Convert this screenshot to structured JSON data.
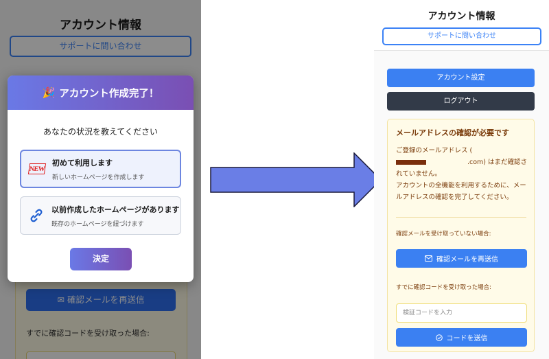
{
  "left": {
    "background": {
      "title": "アカウント情報",
      "support_button": "サポートに問い合わせ",
      "resend_button": "確認メールを再送信",
      "code_label": "すでに確認コードを受け取った場合:"
    },
    "modal": {
      "title": "アカウント作成完了！",
      "question": "あなたの状況を教えてください",
      "options": [
        {
          "title": "初めて利用します",
          "desc": "新しいホームページを作成します",
          "icon": "new-badge-icon",
          "selected": true
        },
        {
          "title": "以前作成したホームページがあります",
          "desc": "既存のホームページを紐づけます",
          "icon": "link-icon",
          "selected": false
        }
      ],
      "confirm_button": "決定",
      "accent_start": "#6a79e6",
      "accent_end": "#7a4fb3"
    }
  },
  "right": {
    "title": "アカウント情報",
    "support_button": "サポートに問い合わせ",
    "settings_button": "アカウント設定",
    "logout_button": "ログアウト",
    "verify": {
      "title": "メールアドレスの確認が必要です",
      "msg_prefix": "ご登録のメールアドレス (",
      "msg_domain": ".com) はまだ確認されていません。",
      "msg_body": "アカウントの全機能を利用するために、メールアドレスの確認を完了してください。",
      "not_received_label": "確認メールを受け取っていない場合:",
      "resend_button": "確認メールを再送信",
      "received_label": "すでに確認コードを受け取った場合:",
      "code_placeholder": "検証コードを入力",
      "send_code_button": "コードを送信"
    },
    "colors": {
      "primary": "#3b80f2",
      "dark": "#323a48",
      "warning_text": "#7a3b0a"
    }
  }
}
